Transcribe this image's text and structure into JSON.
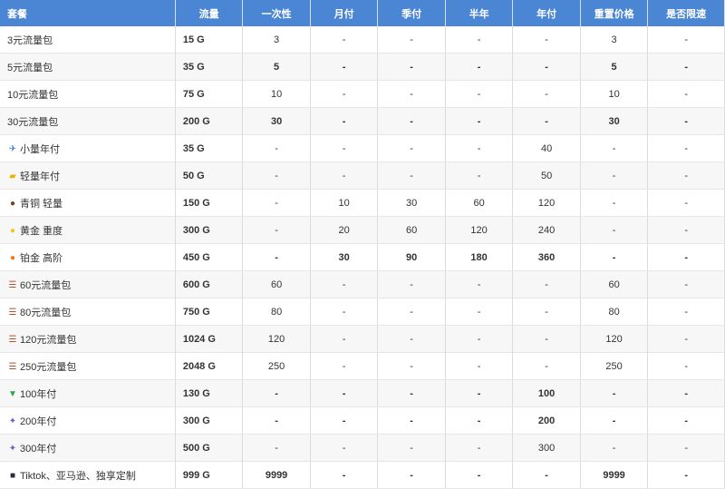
{
  "headers": [
    "套餐",
    "流量",
    "一次性",
    "月付",
    "季付",
    "半年",
    "年付",
    "重置价格",
    "是否限速"
  ],
  "rows": [
    {
      "icon": "",
      "icon_name": "",
      "name": "3元流量包",
      "flow": "15 G",
      "once": "3",
      "monthly": "-",
      "quarterly": "-",
      "half": "-",
      "yearly": "-",
      "reset": "3",
      "limit": "-",
      "bold": false
    },
    {
      "icon": "",
      "icon_name": "",
      "name": "5元流量包",
      "flow": "35 G",
      "once": "5",
      "monthly": "-",
      "quarterly": "-",
      "half": "-",
      "yearly": "-",
      "reset": "5",
      "limit": "-",
      "bold": true
    },
    {
      "icon": "",
      "icon_name": "",
      "name": "10元流量包",
      "flow": "75 G",
      "once": "10",
      "monthly": "-",
      "quarterly": "-",
      "half": "-",
      "yearly": "-",
      "reset": "10",
      "limit": "-",
      "bold": false
    },
    {
      "icon": "",
      "icon_name": "",
      "name": "30元流量包",
      "flow": "200 G",
      "once": "30",
      "monthly": "-",
      "quarterly": "-",
      "half": "-",
      "yearly": "-",
      "reset": "30",
      "limit": "-",
      "bold": true
    },
    {
      "icon": "✈",
      "icon_name": "airplane-icon",
      "icon_color": "#3a7bd5",
      "name": "小量年付",
      "flow": "35 G",
      "once": "-",
      "monthly": "-",
      "quarterly": "-",
      "half": "-",
      "yearly": "40",
      "reset": "-",
      "limit": "-",
      "bold": false
    },
    {
      "icon": "▰",
      "icon_name": "beginner-badge-icon",
      "icon_color": "#e8b400",
      "name": "轻量年付",
      "flow": "50 G",
      "once": "-",
      "monthly": "-",
      "quarterly": "-",
      "half": "-",
      "yearly": "50",
      "reset": "-",
      "limit": "-",
      "bold": false
    },
    {
      "icon": "●",
      "icon_name": "bronze-circle-icon",
      "icon_color": "#6b4226",
      "name": "青铜 轻量",
      "flow": "150 G",
      "once": "-",
      "monthly": "10",
      "quarterly": "30",
      "half": "60",
      "yearly": "120",
      "reset": "-",
      "limit": "-",
      "bold": false
    },
    {
      "icon": "●",
      "icon_name": "gold-circle-icon",
      "icon_color": "#f5c518",
      "name": "黄金 重度",
      "flow": "300 G",
      "once": "-",
      "monthly": "20",
      "quarterly": "60",
      "half": "120",
      "yearly": "240",
      "reset": "-",
      "limit": "-",
      "bold": false
    },
    {
      "icon": "●",
      "icon_name": "orange-circle-icon",
      "icon_color": "#f07a1a",
      "name": "铂金 高阶",
      "flow": "450 G",
      "once": "-",
      "monthly": "30",
      "quarterly": "90",
      "half": "180",
      "yearly": "360",
      "reset": "-",
      "limit": "-",
      "bold": true
    },
    {
      "icon": "☰",
      "icon_name": "ladder-icon",
      "icon_color": "#b5532c",
      "name": "60元流量包",
      "flow": "600 G",
      "once": "60",
      "monthly": "-",
      "quarterly": "-",
      "half": "-",
      "yearly": "-",
      "reset": "60",
      "limit": "-",
      "bold": false
    },
    {
      "icon": "☰",
      "icon_name": "ladder-icon",
      "icon_color": "#b5532c",
      "name": "80元流量包",
      "flow": "750 G",
      "once": "80",
      "monthly": "-",
      "quarterly": "-",
      "half": "-",
      "yearly": "-",
      "reset": "80",
      "limit": "-",
      "bold": false
    },
    {
      "icon": "☰",
      "icon_name": "ladder-icon",
      "icon_color": "#b5532c",
      "name": "120元流量包",
      "flow": "1024 G",
      "once": "120",
      "monthly": "-",
      "quarterly": "-",
      "half": "-",
      "yearly": "-",
      "reset": "120",
      "limit": "-",
      "bold": false
    },
    {
      "icon": "☰",
      "icon_name": "ladder-icon",
      "icon_color": "#b5532c",
      "name": "250元流量包",
      "flow": "2048 G",
      "once": "250",
      "monthly": "-",
      "quarterly": "-",
      "half": "-",
      "yearly": "-",
      "reset": "250",
      "limit": "-",
      "bold": false
    },
    {
      "icon": "▼",
      "icon_name": "dinosaur-icon",
      "icon_color": "#2aa84a",
      "name": "100年付",
      "flow": "130 G",
      "once": "-",
      "monthly": "-",
      "quarterly": "-",
      "half": "-",
      "yearly": "100",
      "reset": "-",
      "limit": "-",
      "bold": true
    },
    {
      "icon": "✦",
      "icon_name": "party-popper-icon",
      "icon_color": "#7a5cc9",
      "name": "200年付",
      "flow": "300 G",
      "once": "-",
      "monthly": "-",
      "quarterly": "-",
      "half": "-",
      "yearly": "200",
      "reset": "-",
      "limit": "-",
      "bold": true
    },
    {
      "icon": "✦",
      "icon_name": "party-popper-icon",
      "icon_color": "#7a5cc9",
      "name": "300年付",
      "flow": "500 G",
      "once": "-",
      "monthly": "-",
      "quarterly": "-",
      "half": "-",
      "yearly": "300",
      "reset": "-",
      "limit": "-",
      "bold": false
    },
    {
      "icon": "■",
      "icon_name": "tiktok-app-icon",
      "icon_color": "#2b2b3a",
      "name": "Tiktok、亚马逊、独享定制",
      "flow": "999 G",
      "once": "9999",
      "monthly": "-",
      "quarterly": "-",
      "half": "-",
      "yearly": "-",
      "reset": "9999",
      "limit": "-",
      "bold": true
    }
  ]
}
